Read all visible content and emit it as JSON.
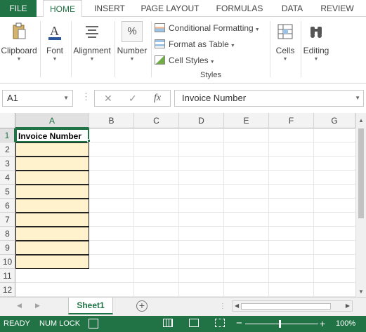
{
  "ribbon_tabs": [
    {
      "label": "FILE"
    },
    {
      "label": "HOME"
    },
    {
      "label": "INSERT"
    },
    {
      "label": "PAGE LAYOUT"
    },
    {
      "label": "FORMULAS"
    },
    {
      "label": "DATA"
    },
    {
      "label": "REVIEW"
    }
  ],
  "active_tab": "HOME",
  "ribbon": {
    "clipboard": {
      "label": "Clipboard",
      "icon": "clipboard-icon"
    },
    "font": {
      "label": "Font",
      "icon": "font-a-icon"
    },
    "alignment": {
      "label": "Alignment",
      "icon": "align-lines-icon"
    },
    "number": {
      "label": "Number",
      "icon": "percent-icon",
      "glyph": "%"
    },
    "styles": {
      "items": [
        {
          "label": "Conditional Formatting",
          "icon": "conditional-formatting-icon"
        },
        {
          "label": "Format as Table",
          "icon": "format-as-table-icon"
        },
        {
          "label": "Cell Styles",
          "icon": "cell-styles-icon"
        }
      ],
      "group_label": "Styles"
    },
    "cells": {
      "label": "Cells",
      "icon": "cells-icon"
    },
    "editing": {
      "label": "Editing",
      "icon": "binoculars-icon"
    }
  },
  "formula_bar": {
    "name_box": "A1",
    "fx_label": "fx",
    "content": "Invoice Number"
  },
  "grid": {
    "columns": [
      "A",
      "B",
      "C",
      "D",
      "E",
      "F",
      "G"
    ],
    "rows": [
      "1",
      "2",
      "3",
      "4",
      "5",
      "6",
      "7",
      "8",
      "9",
      "10",
      "11",
      "12"
    ],
    "selected_column": "A",
    "selected_row": "1",
    "cells": {
      "A1": "Invoice Number"
    },
    "highlight_color": "#fff2cc"
  },
  "sheets": {
    "tabs": [
      "Sheet1"
    ],
    "active": "Sheet1"
  },
  "status": {
    "ready": "READY",
    "num_lock": "NUM LOCK",
    "zoom": "100%",
    "zoom_minus": "−",
    "zoom_plus": "+"
  },
  "colors": {
    "accent": "#217346"
  }
}
